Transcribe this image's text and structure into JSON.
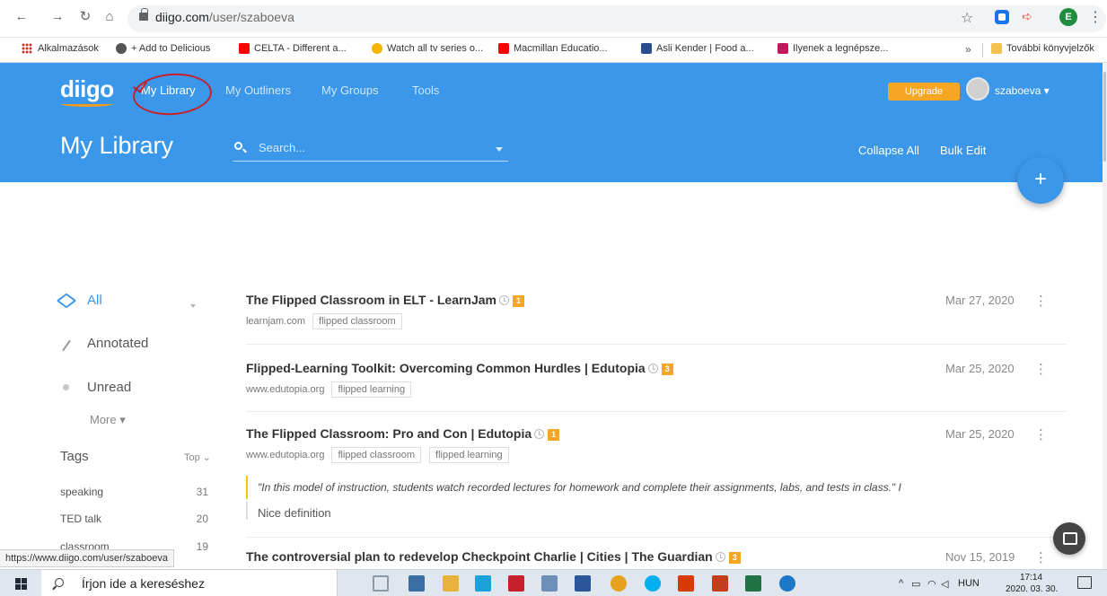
{
  "browser": {
    "url_domain": "diigo.com",
    "url_path": "/user/szaboeva",
    "profile_initial": "E",
    "bookmarks": [
      {
        "label": "Alkalmazások",
        "color": "#d93025"
      },
      {
        "label": "+ Add to Delicious",
        "color": "#555555"
      },
      {
        "label": "CELTA - Different a...",
        "color": "#ff0000"
      },
      {
        "label": "Watch all tv series o...",
        "color": "#f5b400"
      },
      {
        "label": "Macmillan Educatio...",
        "color": "#ff0000"
      },
      {
        "label": "Asli Kender | Food a...",
        "color": "#2a4d8f"
      },
      {
        "label": "Ilyenek a legnépsze...",
        "color": "#c2185b"
      }
    ],
    "bookmarks_more": "»",
    "other_bookmarks": "További könyvjelzők",
    "status_url": "https://www.diigo.com/user/szaboeva"
  },
  "header": {
    "logo": "diigo",
    "nav": [
      "My Library",
      "My Outliners",
      "My Groups",
      "Tools"
    ],
    "upgrade": "Upgrade",
    "username": "szaboeva ▾",
    "page_title": "My Library",
    "search_placeholder": "Search...",
    "collapse_all": "Collapse All",
    "bulk_edit": "Bulk Edit",
    "fab": "+"
  },
  "sidebar": {
    "filters": [
      "All",
      "Annotated",
      "Unread"
    ],
    "more": "More ▾",
    "tags_heading": "Tags",
    "tags_sort": "Top ⌄",
    "tags": [
      {
        "name": "speaking",
        "count": "31"
      },
      {
        "name": "TED talk",
        "count": "20"
      },
      {
        "name": "classroom",
        "count": "19"
      }
    ]
  },
  "items": [
    {
      "title": "The Flipped Classroom in ELT - LearnJam",
      "badge": "1",
      "domain": "learnjam.com",
      "tags": [
        "flipped classroom"
      ],
      "date": "Mar 27, 2020"
    },
    {
      "title": "Flipped-Learning Toolkit: Overcoming Common Hurdles | Edutopia",
      "badge": "3",
      "domain": "www.edutopia.org",
      "tags": [
        "flipped learning"
      ],
      "date": "Mar 25, 2020"
    },
    {
      "title": "The Flipped Classroom: Pro and Con | Edutopia",
      "badge": "1",
      "domain": "www.edutopia.org",
      "tags": [
        "flipped classroom",
        "flipped learning"
      ],
      "date": "Mar 25, 2020"
    },
    {
      "title": "The controversial plan to redevelop Checkpoint Charlie | Cities | The Guardian",
      "badge": "3",
      "domain": "",
      "tags": [],
      "date": "Nov 15, 2019"
    }
  ],
  "annotation": {
    "quote": "\"In this model of instruction, students watch recorded lectures for homework and complete their assignments, labs, and tests in class.\" I",
    "note": "Nice definition"
  },
  "taskbar": {
    "search_placeholder": "Írjon ide a kereséshez",
    "language": "HUN",
    "time": "17:14",
    "date": "2020. 03. 30.",
    "apps": [
      {
        "name": "task-view",
        "color": "#8a99a8"
      },
      {
        "name": "store",
        "color": "#3a6ea5"
      },
      {
        "name": "file-explorer",
        "color": "#e8b33c"
      },
      {
        "name": "lingo",
        "color": "#1aa3d8"
      },
      {
        "name": "mcafee",
        "color": "#c8202a"
      },
      {
        "name": "paint",
        "color": "#6d8fb8"
      },
      {
        "name": "word",
        "color": "#2b579a"
      },
      {
        "name": "chrome",
        "color": "#e6a21f"
      },
      {
        "name": "skype",
        "color": "#00aff0"
      },
      {
        "name": "office",
        "color": "#d83b01"
      },
      {
        "name": "powerpoint",
        "color": "#c43e1c"
      },
      {
        "name": "excel",
        "color": "#217346"
      },
      {
        "name": "edge",
        "color": "#1e78c8"
      }
    ]
  }
}
